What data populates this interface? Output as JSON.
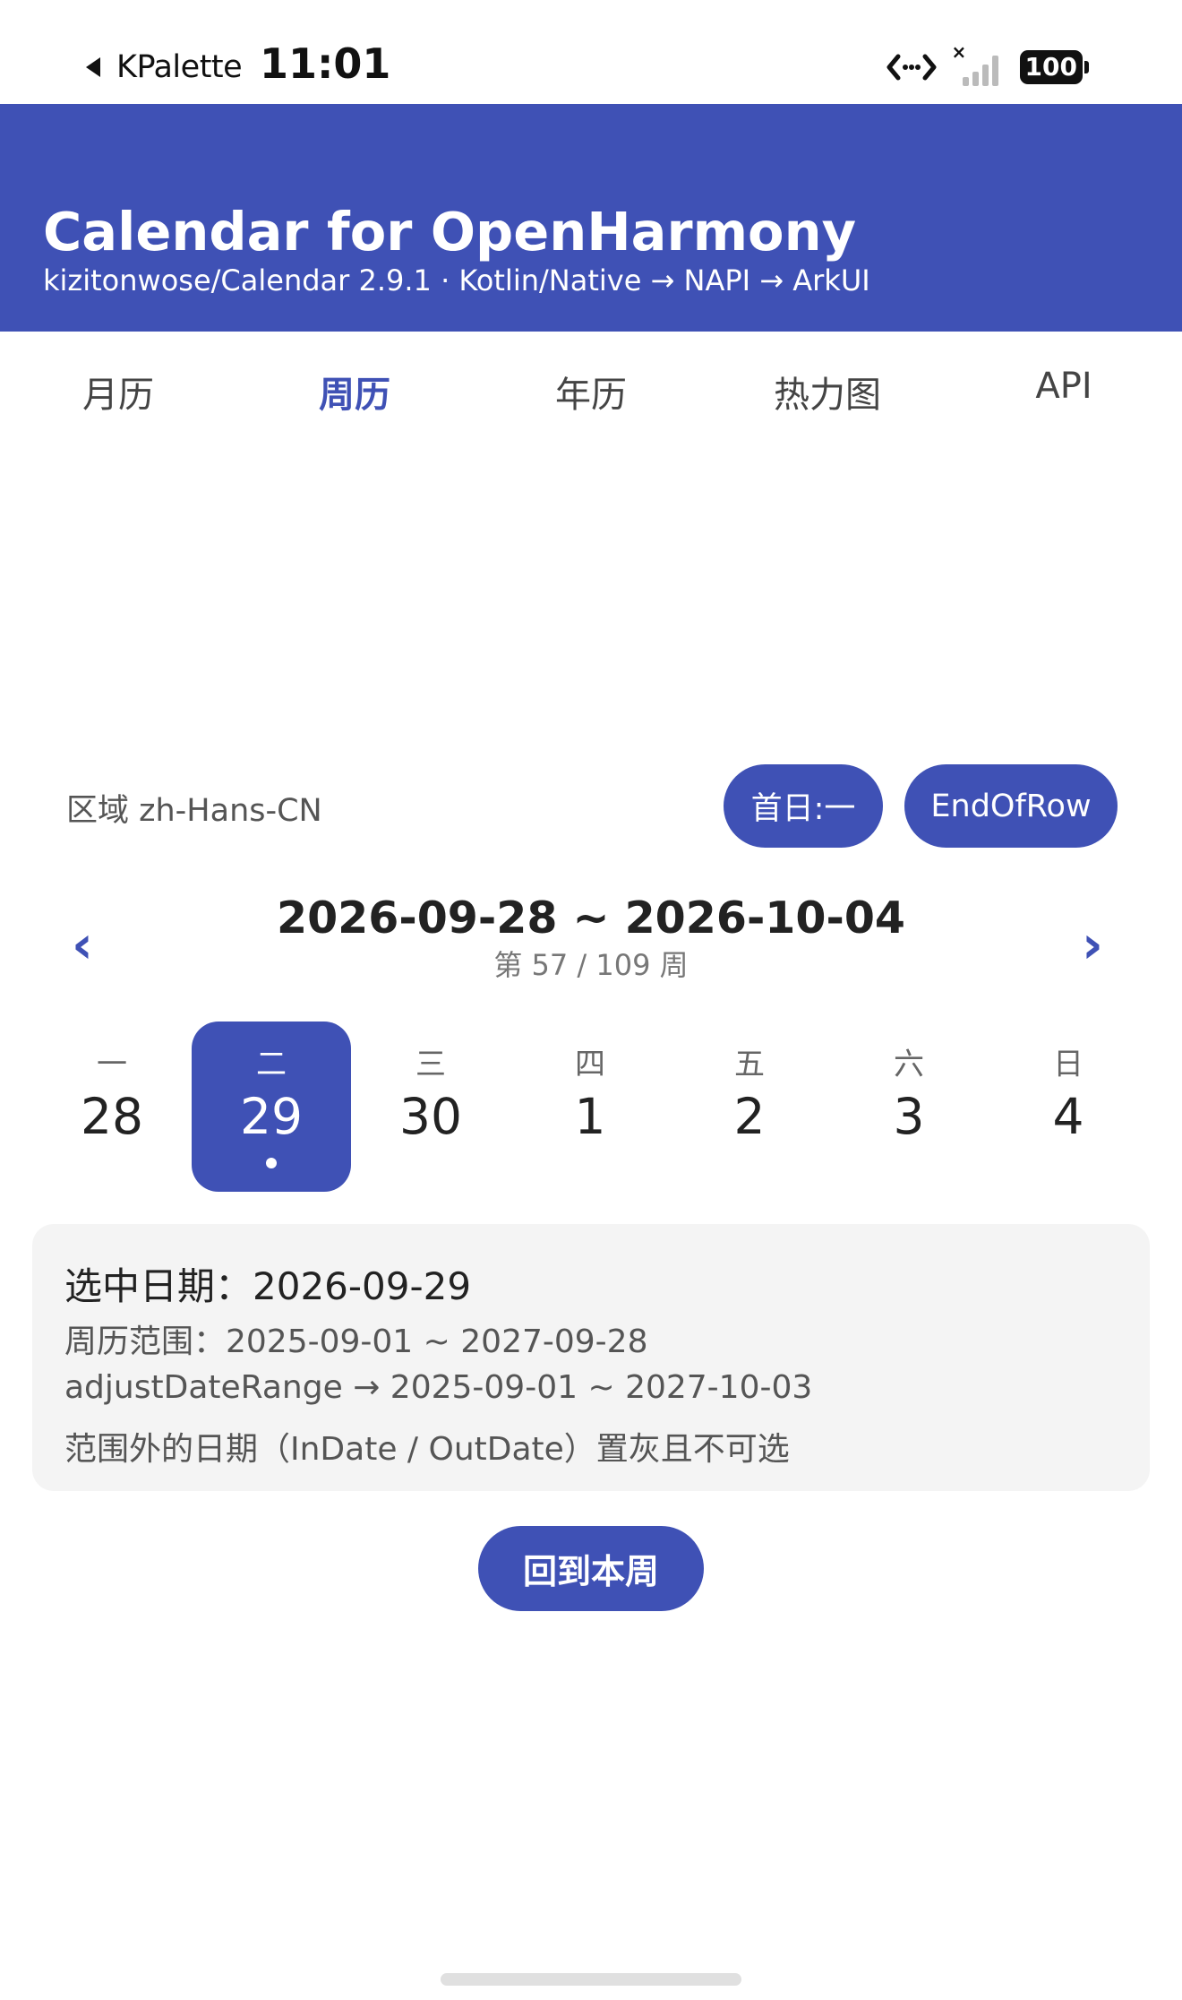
{
  "status_bar": {
    "back_app": "KPalette",
    "time": "11:01",
    "battery": "100",
    "signal_mark": "×"
  },
  "header": {
    "title": "Calendar for OpenHarmony",
    "subtitle": "kizitonwose/Calendar 2.9.1 · Kotlin/Native → NAPI → ArkUI",
    "background_color": "#3f51b5"
  },
  "tabs": [
    {
      "label": "月历",
      "active": false
    },
    {
      "label": "周历",
      "active": true
    },
    {
      "label": "年历",
      "active": false
    },
    {
      "label": "热力图",
      "active": false
    },
    {
      "label": "API",
      "active": false
    }
  ],
  "locale": {
    "label": "区域 zh-Hans-CN",
    "first_day_button": "首日:一",
    "row_mode_button": "EndOfRow"
  },
  "week_header": {
    "prev_arrow": "‹",
    "next_arrow": "›",
    "range": "2026-09-28 ~ 2026-10-04",
    "week_index": "第 57 / 109 周"
  },
  "days": [
    {
      "weekday": "一",
      "number": "28",
      "selected": false
    },
    {
      "weekday": "二",
      "number": "29",
      "selected": true
    },
    {
      "weekday": "三",
      "number": "30",
      "selected": false
    },
    {
      "weekday": "四",
      "number": "1",
      "selected": false
    },
    {
      "weekday": "五",
      "number": "2",
      "selected": false
    },
    {
      "weekday": "六",
      "number": "3",
      "selected": false
    },
    {
      "weekday": "日",
      "number": "4",
      "selected": false
    }
  ],
  "info": {
    "selected_date": "选中日期：2026-09-29",
    "week_range": "周历范围：2025-09-01 ~ 2027-09-28",
    "adjust_range": "adjustDateRange → 2025-09-01 ~ 2027-10-03",
    "out_of_range_note": "范围外的日期（InDate / OutDate）置灰且不可选"
  },
  "today_button": "回到本周",
  "accent_color": "#3f51b5"
}
